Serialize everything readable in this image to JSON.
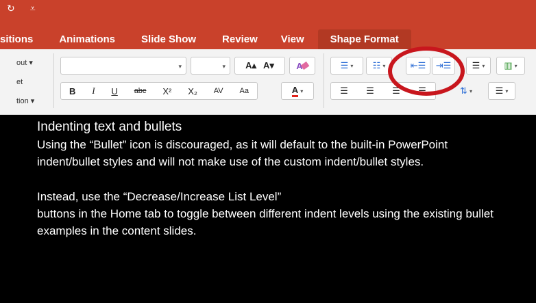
{
  "ribbon": {
    "tabs": [
      {
        "label": "sitions",
        "active": false
      },
      {
        "label": "Animations",
        "active": false
      },
      {
        "label": "Slide Show",
        "active": false
      },
      {
        "label": "Review",
        "active": false
      },
      {
        "label": "View",
        "active": false
      },
      {
        "label": "Shape Format",
        "active": true
      }
    ],
    "left_labels": [
      "out ▾",
      "et",
      "tion ▾"
    ],
    "font_name_value": "",
    "font_size_value": "",
    "format_buttons": {
      "bold": "B",
      "italic": "I",
      "underline": "U",
      "strikethrough": "abc",
      "superscript": "X²",
      "subscript": "X₂",
      "char_spacing": "AV",
      "change_case": "Aa",
      "font_color": "A",
      "grow_font": "A▴",
      "shrink_font": "A▾"
    },
    "accent_color": "#c9412b"
  },
  "content": {
    "heading": "Indenting text and bullets",
    "paragraph1": "Using the “Bullet” icon is discouraged, as it will default to the built-in PowerPoint indent/bullet styles and will not make use of the custom indent/bullet styles.",
    "paragraph2_line1": "Instead, use the “Decrease/Increase List Level”",
    "paragraph2_line2": "buttons in the Home tab to toggle between different indent levels using the existing bullet examples in the content slides."
  }
}
